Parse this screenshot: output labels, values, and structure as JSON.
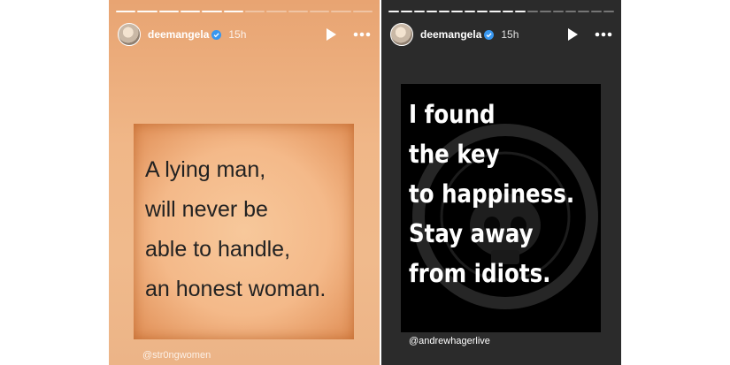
{
  "stories": [
    {
      "username": "deemangela",
      "time": "15h",
      "progress": {
        "segments": 12,
        "completed": 6
      },
      "quote_lines": [
        "A lying man,",
        "will never be",
        "able to handle,",
        "an honest woman."
      ],
      "source_tag": "@str0ngwomen"
    },
    {
      "username": "deemangela",
      "time": "15h",
      "progress": {
        "segments": 18,
        "completed": 11
      },
      "quote_lines": [
        "I found",
        "the key",
        "to happiness.",
        "Stay away",
        "from idiots."
      ],
      "source_tag": "@andrewhagerlive"
    }
  ],
  "icons": {
    "verified": "verified-badge-icon",
    "play": "play-icon",
    "more": "more-options-icon"
  },
  "colors": {
    "story1_bg": "#f0b788",
    "story2_bg": "#2b2b2b",
    "verified_blue": "#3897f0"
  }
}
